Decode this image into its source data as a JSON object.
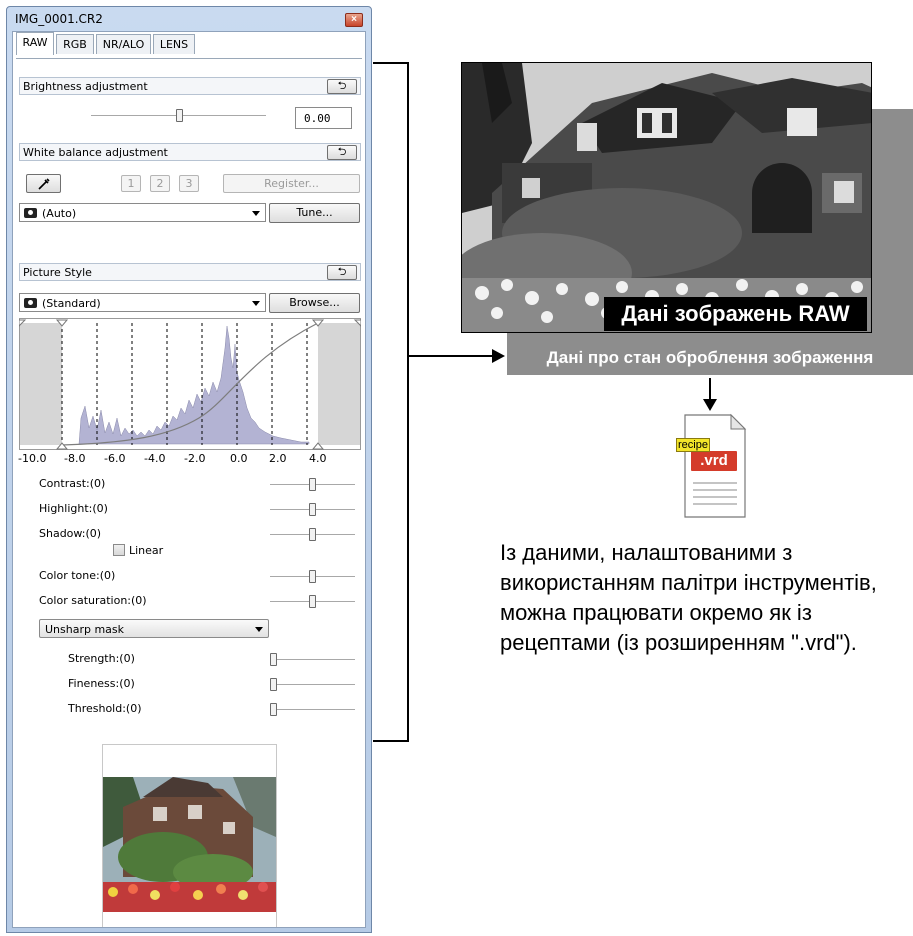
{
  "window": {
    "title": "IMG_0001.CR2",
    "close_glyph": "×"
  },
  "tabs": [
    {
      "label": "RAW",
      "active": true
    },
    {
      "label": "RGB",
      "active": false
    },
    {
      "label": "NR/ALO",
      "active": false
    },
    {
      "label": "LENS",
      "active": false
    }
  ],
  "brightness": {
    "title": "Brightness adjustment",
    "value": "0.00",
    "reset_glyph": "⮌"
  },
  "white_balance": {
    "title": "White balance adjustment",
    "presets": [
      "1",
      "2",
      "3"
    ],
    "register_label": "Register...",
    "mode": "(Auto)",
    "tune_label": "Tune..."
  },
  "picture_style": {
    "title": "Picture Style",
    "style": "(Standard)",
    "browse_label": "Browse...",
    "histogram_ticks": [
      "-10.0",
      "-8.0",
      "-6.0",
      "-4.0",
      "-2.0",
      "0.0",
      "2.0",
      "4.0"
    ],
    "contrast_label": "Contrast:(0)",
    "highlight_label": "Highlight:(0)",
    "shadow_label": "Shadow:(0)",
    "linear_label": "Linear",
    "color_tone_label": "Color tone:(0)",
    "color_saturation_label": "Color saturation:(0)",
    "unsharp_mode": "Unsharp mask",
    "strength_label": "Strength:(0)",
    "fineness_label": "Fineness:(0)",
    "threshold_label": "Threshold:(0)"
  },
  "annotation": {
    "raw_label": "Дані зображень RAW",
    "state_label": "Дані про стан оброблення зображення",
    "recipe_tag": "recipe",
    "recipe_ext": ".vrd",
    "description": "Із даними, налаштованими з використанням палітри інструментів, можна працювати окремо як із рецептами (із розширенням \".vrd\")."
  },
  "colors": {
    "histogram_fill": "#b3b3d3",
    "panel_border": "#6e87a8",
    "label_gray": "#8d8d8d",
    "recipe_red": "#d43b2a",
    "recipe_yellow": "#f3e52a"
  }
}
